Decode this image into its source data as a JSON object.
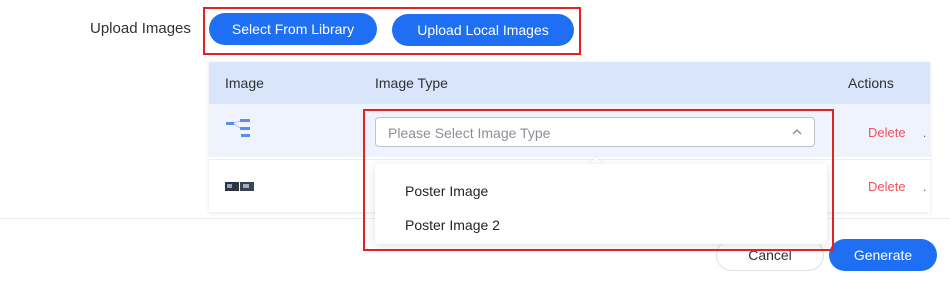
{
  "form": {
    "upload_label": "Upload Images",
    "select_library_label": "Select From Library",
    "upload_local_label": "Upload Local Images"
  },
  "table": {
    "headers": {
      "image": "Image",
      "image_type": "Image Type",
      "actions": "Actions"
    },
    "rows": [
      {
        "delete_label": "Delete",
        "more": "."
      },
      {
        "delete_label": "Delete",
        "more": "."
      }
    ]
  },
  "image_type_select": {
    "placeholder": "Please Select Image Type",
    "options": [
      "Poster Image",
      "Poster Image 2"
    ]
  },
  "footer": {
    "cancel_label": "Cancel",
    "generate_label": "Generate"
  },
  "colors": {
    "primary": "#1f6ff5",
    "danger": "#f0525c",
    "highlight": "#e02424"
  }
}
